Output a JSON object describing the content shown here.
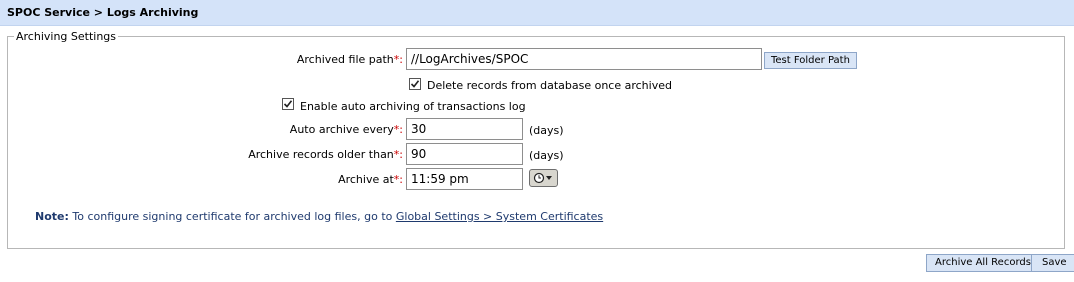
{
  "header": {
    "title": "SPOC Service > Logs Archiving"
  },
  "archiving_settings": {
    "legend": "Archiving Settings",
    "archived_file_path": {
      "label": "Archived file path",
      "required_mark": "*:",
      "value": "//LogArchives/SPOC",
      "test_button": "Test Folder Path"
    },
    "delete_records": {
      "checked": true,
      "label": "Delete records from database once archived"
    },
    "enable_auto_archiving": {
      "checked": true,
      "label": "Enable auto archiving of transactions log"
    },
    "auto_archive_every": {
      "label": "Auto archive every",
      "required_mark": "*:",
      "value": "30",
      "unit": "(days)"
    },
    "archive_older_than": {
      "label": "Archive records older than",
      "required_mark": "*:",
      "value": "90",
      "unit": "(days)"
    },
    "archive_at": {
      "label": "Archive at",
      "required_mark": "*:",
      "value": "11:59 pm",
      "picker_icon": "clock-icon"
    },
    "note": {
      "label": "Note:",
      "text": " To configure signing certificate for archived log files, go to ",
      "link": "Global Settings > System Certificates"
    }
  },
  "footer": {
    "archive_all_button": "Archive All Records",
    "save_button": "Save"
  },
  "colors": {
    "header_bg": "#d4e3f9",
    "button_bg": "#d9e5f6",
    "required": "#cc0000",
    "note_text": "#1f3a6e"
  }
}
